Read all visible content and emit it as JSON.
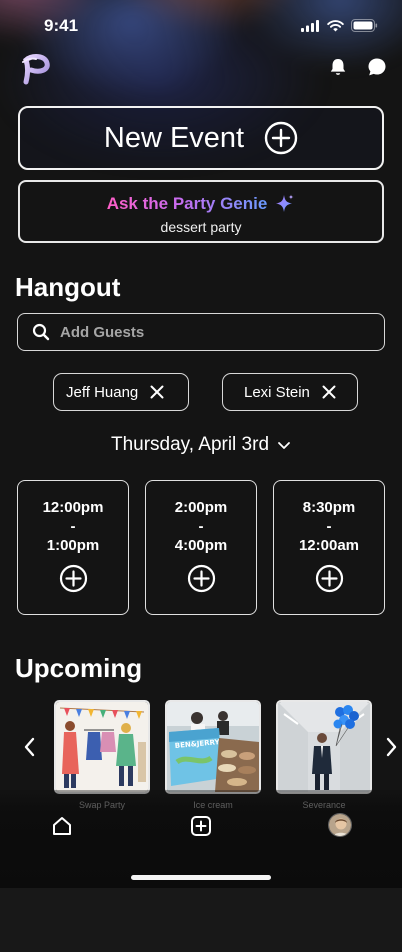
{
  "status_bar": {
    "time": "9:41"
  },
  "header": {
    "logo_icon": "party-p-logo",
    "notification_icon": "bell-icon",
    "messages_icon": "chat-bubble-icon"
  },
  "new_event": {
    "label": "New Event",
    "icon": "plus-circle-icon"
  },
  "genie": {
    "title": "Ask the Party Genie",
    "subtitle": "dessert party",
    "icon": "sparkle-icon",
    "gradient": [
      "#ff5fc8",
      "#c96cf0",
      "#6a9bff"
    ]
  },
  "hangout": {
    "title": "Hangout",
    "search_placeholder": "Add Guests",
    "guests": [
      {
        "name": "Jeff Huang"
      },
      {
        "name": "Lexi Stein"
      }
    ],
    "date": "Thursday, April 3rd",
    "time_slots": [
      {
        "start": "12:00pm",
        "sep": "-",
        "end": "1:00pm"
      },
      {
        "start": "2:00pm",
        "sep": "-",
        "end": "4:00pm"
      },
      {
        "start": "8:30pm",
        "sep": "-",
        "end": "12:00am"
      }
    ]
  },
  "upcoming": {
    "title": "Upcoming",
    "events": [
      {
        "label": "Swap Party"
      },
      {
        "label": "Ice cream"
      },
      {
        "label": "Severance"
      }
    ]
  },
  "tabbar": {
    "items": [
      {
        "name": "home",
        "icon": "home-icon"
      },
      {
        "name": "create",
        "icon": "plus-square-icon"
      },
      {
        "name": "profile",
        "icon": "avatar"
      }
    ]
  },
  "colors": {
    "background": "#141414",
    "text": "#ffffff",
    "muted": "#a5a5a5"
  }
}
